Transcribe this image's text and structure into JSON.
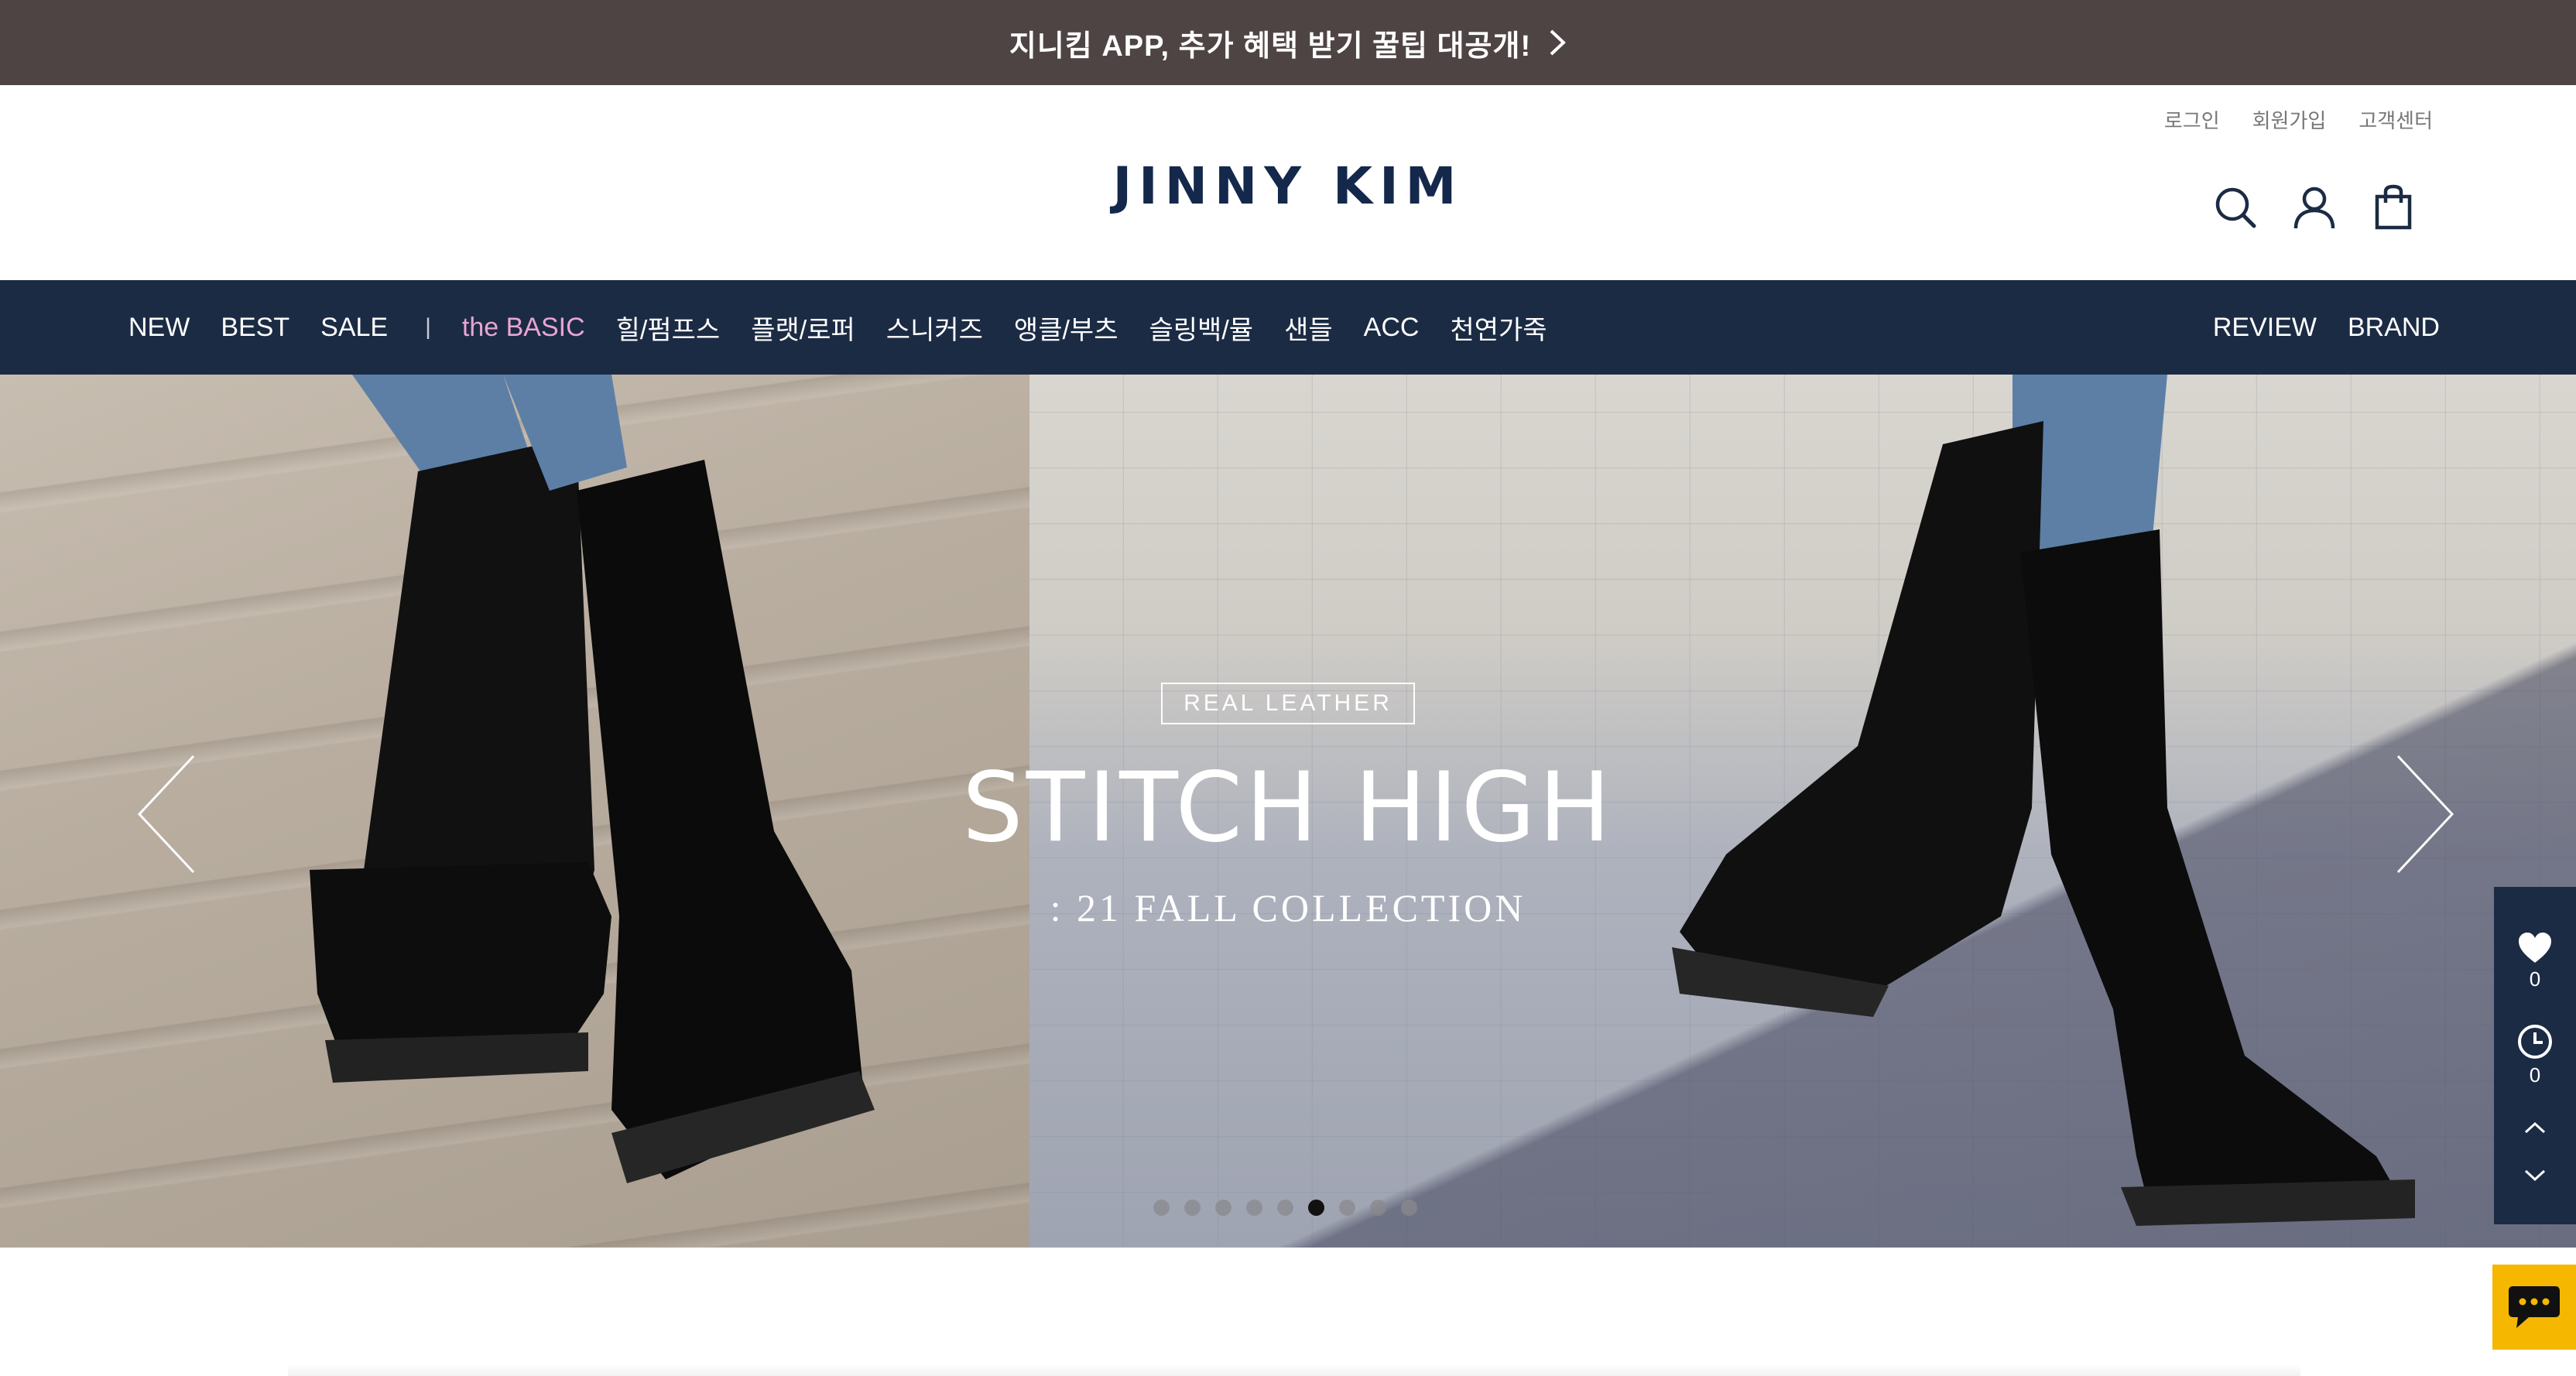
{
  "promo": {
    "text": "지니킴 APP, 추가 혜택 받기 꿀팁 대공개!",
    "chevron_icon": "chevron-right-icon",
    "background": "#4e4443"
  },
  "header": {
    "util_links": {
      "login": "로그인",
      "signup": "회원가입",
      "support": "고객센터"
    },
    "logo": "JINNY KIM",
    "logo_color": "#14284b",
    "icons": [
      "search-icon",
      "user-icon",
      "shopping-bag-icon"
    ]
  },
  "nav": {
    "background": "#1b2b44",
    "left_items": [
      "NEW",
      "BEST",
      "SALE"
    ],
    "separator": "|",
    "highlight_item": "the BASIC",
    "highlight_color": "#e9a5d2",
    "category_items": [
      "힐/펌프스",
      "플랫/로퍼",
      "스니커즈",
      "앵클/부츠",
      "슬링백/뮬",
      "샌들",
      "ACC",
      "천연가죽"
    ],
    "right_items": [
      "REVIEW",
      "BRAND"
    ]
  },
  "hero": {
    "tag": "REAL LEATHER",
    "title": "STITCH HIGH",
    "subtitle": ": 21 FALL COLLECTION",
    "prev_icon": "chevron-left-icon",
    "next_icon": "chevron-right-icon",
    "slide_count": 9,
    "active_slide": 6
  },
  "quick_panel": {
    "wishlist_icon": "heart-icon",
    "wishlist_count": "0",
    "recent_icon": "clock-icon",
    "recent_count": "0",
    "up_icon": "chevron-up-icon",
    "down_icon": "chevron-down-icon"
  },
  "chat": {
    "icon": "chat-bubble-icon",
    "color": "#f5b700"
  }
}
